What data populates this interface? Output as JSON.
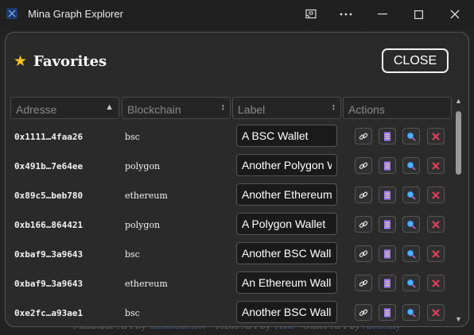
{
  "window": {
    "title": "Mina Graph Explorer",
    "controls": [
      "cast-icon",
      "more-icon",
      "minimize-icon",
      "maximize-icon",
      "close-icon"
    ]
  },
  "footer": {
    "p1": "Minataur API by ",
    "l1": "minataur.net",
    "p2": " - Tezos API by ",
    "l2": "TzKt",
    "p3": " - Other API by ",
    "l3": "Alchemy"
  },
  "modal": {
    "title": "Favorites",
    "close_label": "CLOSE",
    "columns": [
      {
        "label": "Adresse",
        "sort": "▲"
      },
      {
        "label": "Blockchain",
        "sort": "↕"
      },
      {
        "label": "Label",
        "sort": "↕"
      },
      {
        "label": "Actions",
        "sort": ""
      }
    ],
    "rows": [
      {
        "address": "0x1111…4faa26",
        "chain": "bsc",
        "label": "A BSC Wallet"
      },
      {
        "address": "0x491b…7e64ee",
        "chain": "polygon",
        "label": "Another Polygon Wallet"
      },
      {
        "address": "0x89c5…beb780",
        "chain": "ethereum",
        "label": "Another Ethereum Wallet"
      },
      {
        "address": "0xb166…864421",
        "chain": "polygon",
        "label": "A Polygon Wallet"
      },
      {
        "address": "0xbaf9…3a9643",
        "chain": "bsc",
        "label": "Another BSC Wallet"
      },
      {
        "address": "0xbaf9…3a9643",
        "chain": "ethereum",
        "label": "An Ethereum Wallet"
      },
      {
        "address": "0xe2fc…a93ae1",
        "chain": "bsc",
        "label": "Another BSC Wallet"
      }
    ],
    "action_icons": [
      "link-icon",
      "document-icon",
      "search-icon",
      "delete-icon"
    ],
    "colors": {
      "star": "#f5c518",
      "delete": "#e0405a",
      "search": "#3aa0ff",
      "doc": "#9b7cf0"
    }
  }
}
